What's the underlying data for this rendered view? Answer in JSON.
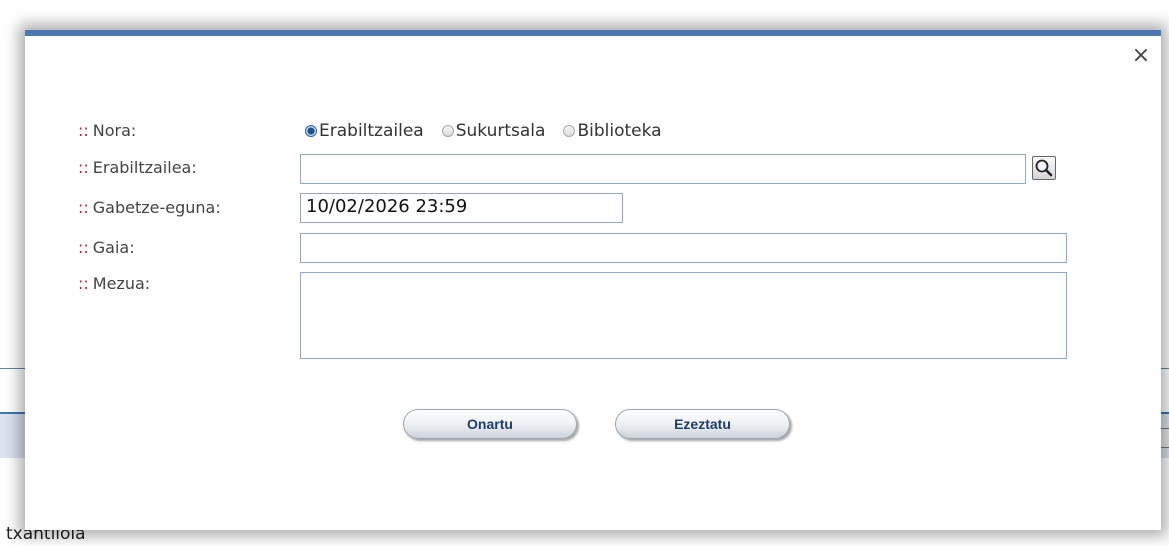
{
  "background": {
    "partial_text": "txantiloia"
  },
  "dialog": {
    "close_glyph": "×",
    "label_prefix": "::",
    "fields": {
      "nora_label": "Nora:",
      "erabiltzailea_label": "Erabiltzailea:",
      "gabetze_label": "Gabetze-eguna:",
      "gaia_label": "Gaia:",
      "mezua_label": "Mezua:"
    },
    "radio_options": [
      {
        "label": "Erabiltzailea",
        "selected": true
      },
      {
        "label": "Sukurtsala",
        "selected": false
      },
      {
        "label": "Biblioteka",
        "selected": false
      }
    ],
    "inputs": {
      "erabiltzailea_value": "",
      "gabetze_value": "10/02/2026 23:59",
      "gaia_value": "",
      "mezua_value": ""
    },
    "buttons": {
      "accept": "Onartu",
      "cancel": "Ezeztatu"
    },
    "colors": {
      "accent": "#4a78b2",
      "label_prefix": "#b32828"
    },
    "icons": {
      "search": "magnifier-icon",
      "close": "close-icon"
    }
  }
}
